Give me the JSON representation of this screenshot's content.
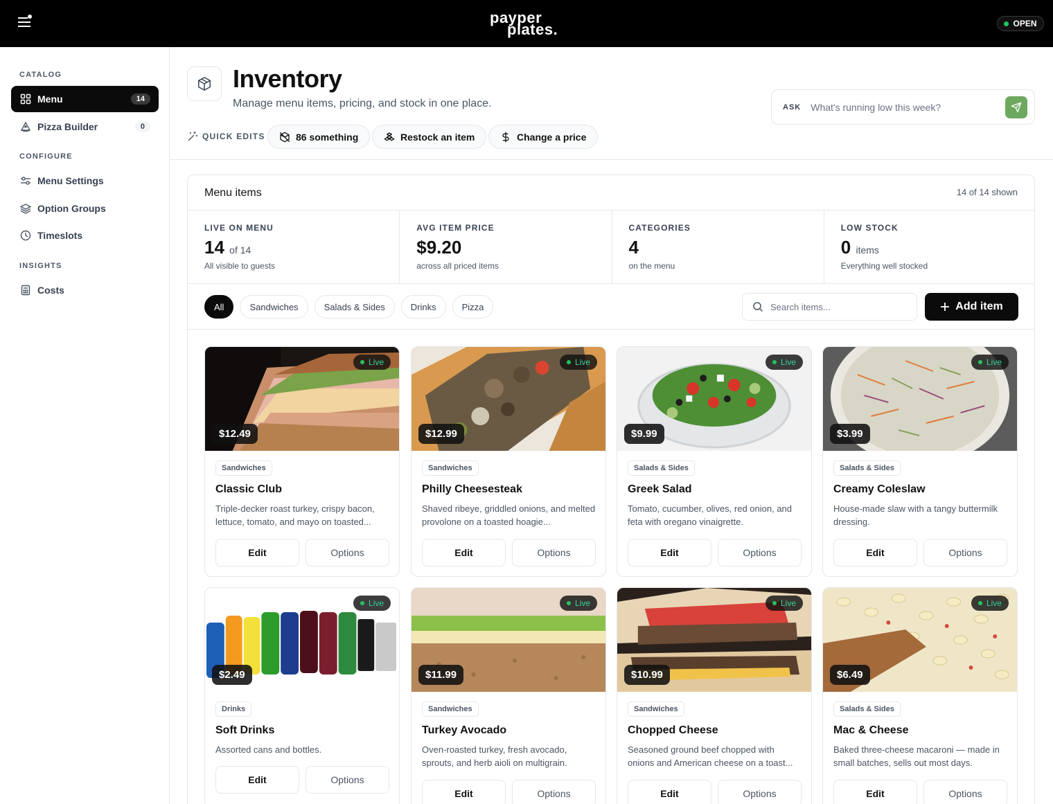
{
  "topbar": {
    "logo_line1": "payper",
    "logo_line2": "plates.",
    "status": "OPEN"
  },
  "sidebar": {
    "sections": [
      {
        "label": "CATALOG",
        "items": [
          {
            "label": "Menu",
            "count": "14",
            "icon": "grid-icon",
            "active": true
          },
          {
            "label": "Pizza Builder",
            "count": "0",
            "icon": "pizza-icon",
            "active": false
          }
        ]
      },
      {
        "label": "CONFIGURE",
        "items": [
          {
            "label": "Menu Settings",
            "icon": "sliders-icon"
          },
          {
            "label": "Option Groups",
            "icon": "layers-icon"
          },
          {
            "label": "Timeslots",
            "icon": "clock-icon"
          }
        ]
      },
      {
        "label": "INSIGHTS",
        "items": [
          {
            "label": "Costs",
            "icon": "calculator-icon"
          }
        ]
      }
    ]
  },
  "header": {
    "title": "Inventory",
    "subtitle": "Manage menu items, pricing, and stock in one place.",
    "ask_label": "ASK",
    "ask_placeholder": "What's running low this week?",
    "quick_edits_label": "QUICK EDITS",
    "quick_edits": [
      {
        "label": "86 something",
        "icon": "box-off-icon"
      },
      {
        "label": "Restock an item",
        "icon": "boxes-icon"
      },
      {
        "label": "Change a price",
        "icon": "dollar-icon"
      }
    ]
  },
  "panel": {
    "title": "Menu items",
    "count_text": "14 of 14 shown",
    "stats": [
      {
        "label": "LIVE ON MENU",
        "value": "14",
        "suffix": "of 14",
        "note": "All visible to guests"
      },
      {
        "label": "AVG ITEM PRICE",
        "value": "$9.20",
        "suffix": "",
        "note": "across all priced items"
      },
      {
        "label": "CATEGORIES",
        "value": "4",
        "suffix": "",
        "note": "on the menu"
      },
      {
        "label": "LOW STOCK",
        "value": "0",
        "suffix": "items",
        "note": "Everything well stocked"
      }
    ],
    "filters": [
      "All",
      "Sandwiches",
      "Salads & Sides",
      "Drinks",
      "Pizza"
    ],
    "active_filter": "All",
    "search_placeholder": "Search items...",
    "add_label": "Add item"
  },
  "items": [
    {
      "name": "Classic Club",
      "category": "Sandwiches",
      "price": "$12.49",
      "status": "Live",
      "desc": "Triple-decker roast turkey, crispy bacon, lettuce, tomato, and mayo on toasted...",
      "edit": "Edit",
      "options": "Options"
    },
    {
      "name": "Philly Cheesesteak",
      "category": "Sandwiches",
      "price": "$12.99",
      "status": "Live",
      "desc": "Shaved ribeye, griddled onions, and melted provolone on a toasted hoagie...",
      "edit": "Edit",
      "options": "Options"
    },
    {
      "name": "Greek Salad",
      "category": "Salads & Sides",
      "price": "$9.99",
      "status": "Live",
      "desc": "Tomato, cucumber, olives, red onion, and feta with oregano vinaigrette.",
      "edit": "Edit",
      "options": "Options"
    },
    {
      "name": "Creamy Coleslaw",
      "category": "Salads & Sides",
      "price": "$3.99",
      "status": "Live",
      "desc": "House-made slaw with a tangy buttermilk dressing.",
      "edit": "Edit",
      "options": "Options"
    },
    {
      "name": "Soft Drinks",
      "category": "Drinks",
      "price": "$2.49",
      "status": "Live",
      "desc": "Assorted cans and bottles.",
      "edit": "Edit",
      "options": "Options"
    },
    {
      "name": "Turkey Avocado",
      "category": "Sandwiches",
      "price": "$11.99",
      "status": "Live",
      "desc": "Oven-roasted turkey, fresh avocado, sprouts, and herb aioli on multigrain.",
      "edit": "Edit",
      "options": "Options"
    },
    {
      "name": "Chopped Cheese",
      "category": "Sandwiches",
      "price": "$10.99",
      "status": "Live",
      "desc": "Seasoned ground beef chopped with onions and American cheese on a toast...",
      "edit": "Edit",
      "options": "Options"
    },
    {
      "name": "Mac & Cheese",
      "category": "Salads & Sides",
      "price": "$6.49",
      "status": "Live",
      "desc": "Baked three-cheese macaroni — made in small batches, sells out most days.",
      "edit": "Edit",
      "options": "Options"
    }
  ],
  "colors": {
    "accent_dark": "#0b0b0b",
    "live_green": "#22c55e",
    "send_button": "#6ea85f"
  }
}
